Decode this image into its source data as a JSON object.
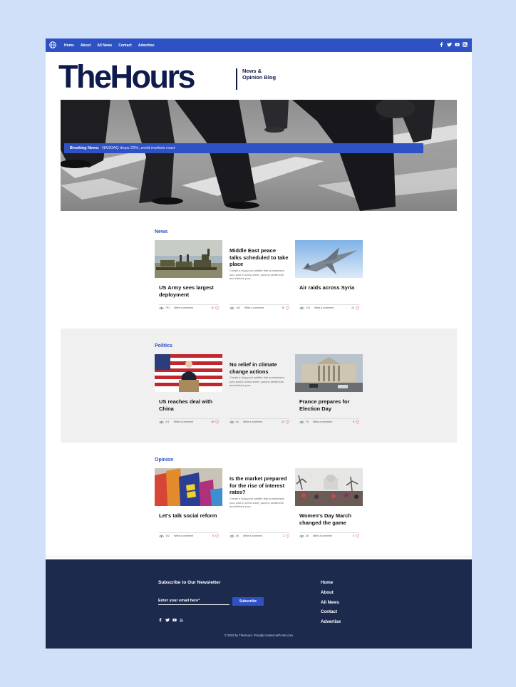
{
  "nav": {
    "items": [
      "Home",
      "About",
      "All News",
      "Contact",
      "Advertise"
    ]
  },
  "brand": {
    "title": "TheHours",
    "tagline": "News & Opinion Blog"
  },
  "breaking": {
    "label": "Breaking News:",
    "text": "NASDAQ drops 20%, world markets react"
  },
  "sections": [
    {
      "heading": "News",
      "cards": [
        {
          "title": "US Army sees largest deployment",
          "views": "791",
          "comment": "Write a comment",
          "likes": "12",
          "image": "tanks"
        },
        {
          "title": "Middle East peace talks scheduled to take place",
          "excerpt": "Create a blog post subtitle that summarizes your post in a few short, punchy sentences and entices your...",
          "views": "244",
          "comment": "Write a comment",
          "likes": "26"
        },
        {
          "title": "Air raids across Syria",
          "views": "214",
          "comment": "Write a comment",
          "likes": "15",
          "image": "jet"
        }
      ]
    },
    {
      "heading": "Politics",
      "cards": [
        {
          "title": "US reaches deal with China",
          "views": "211",
          "comment": "Write a comment",
          "likes": "18",
          "image": "podium"
        },
        {
          "title": "No relief in climate change actions",
          "excerpt": "Create a blog post subtitle that summarizes your post in a few short, punchy sentences and entices your...",
          "views": "81",
          "comment": "Write a comment",
          "likes": "12"
        },
        {
          "title": "France prepares for Election Day",
          "views": "79",
          "comment": "Write a comment",
          "likes": "6",
          "image": "building"
        }
      ]
    },
    {
      "heading": "Opinion",
      "cards": [
        {
          "title": "Let's talk social reform",
          "views": "102",
          "comment": "Write a comment",
          "likes": "5",
          "image": "flags"
        },
        {
          "title": "Is the market prepared for the rise of interest rates?",
          "excerpt": "Create a blog post subtitle that summarizes your post in a few short, punchy sentences and entices your...",
          "views": "56",
          "comment": "Write a comment",
          "likes": "2"
        },
        {
          "title": "Women's Day March changed the game",
          "views": "38",
          "comment": "Write a comment",
          "likes": "5",
          "image": "march"
        }
      ]
    }
  ],
  "footer": {
    "newsletter_title": "Subscribe to Our Newsletter",
    "email_placeholder": "Enter your email here*",
    "subscribe_label": "Subscribe",
    "nav": [
      "Home",
      "About",
      "All News",
      "Contact",
      "Advertise"
    ],
    "copyright": "© 2023 by TheHours. Proudly created with Wix.com"
  },
  "colors": {
    "accent": "#2e52c4",
    "navy": "#101b4d",
    "footer": "#1b2a4d",
    "heart": "#e0403b"
  },
  "icons": [
    "globe-icon",
    "facebook-icon",
    "twitter-icon",
    "youtube-icon",
    "rss-icon",
    "eye-icon",
    "heart-icon"
  ]
}
